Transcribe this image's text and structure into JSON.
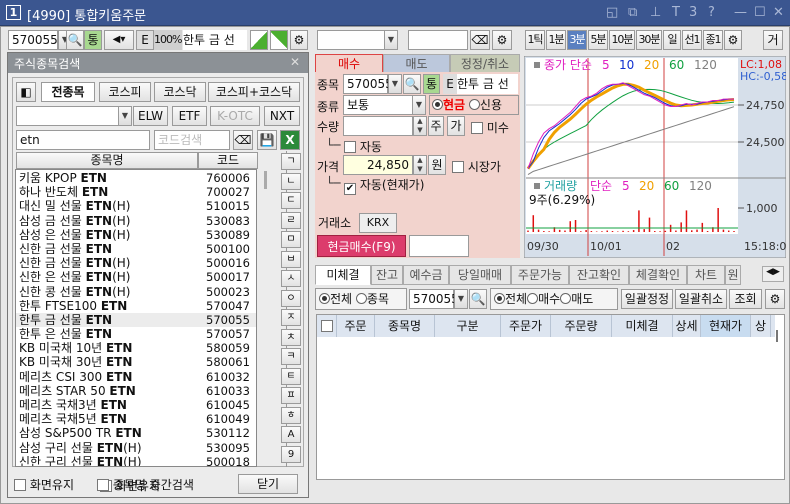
{
  "window": {
    "badge": "1",
    "title": "[4990] 통합키움주문",
    "icons": [
      "restore-layout-icon",
      "cascade-icon",
      "pin-icon",
      "font-icon",
      "three-icon",
      "help-icon",
      "minimize-icon",
      "maximize-icon",
      "close-icon"
    ],
    "icon_glyphs": [
      "◱",
      "⧉",
      "⊥",
      "T",
      "3",
      "?",
      "—",
      "☐",
      "✕"
    ]
  },
  "toolbar": {
    "code": "570055",
    "tong": "통",
    "e": "E",
    "ratio": "100%",
    "name": "한투 금 선"
  },
  "dialog": {
    "title": "주식종목검색",
    "close": "✕",
    "tabs": [
      "전종목",
      "코스피",
      "코스닥",
      "코스피+코스닥"
    ],
    "market_buttons": [
      "ELW",
      "ETF",
      "K-OTC",
      "NXT"
    ],
    "search_value": "etn",
    "code_placeholder": "코드검색",
    "col_name": "종목명",
    "col_code": "코드",
    "rows": [
      {
        "name": "키움 KPOP ",
        "bold": "ETN",
        "suffix": "",
        "code": "760006"
      },
      {
        "name": "하나 반도체 ",
        "bold": "ETN",
        "suffix": "",
        "code": "700027"
      },
      {
        "name": "대신 밀 선물 ",
        "bold": "ETN",
        "suffix": "(H)",
        "code": "510015"
      },
      {
        "name": "삼성 금 선물 ",
        "bold": "ETN",
        "suffix": "(H)",
        "code": "530083"
      },
      {
        "name": "삼성 은 선물 ",
        "bold": "ETN",
        "suffix": "(H)",
        "code": "530089"
      },
      {
        "name": "신한 금 선물 ",
        "bold": "ETN",
        "suffix": "",
        "code": "500100"
      },
      {
        "name": "신한 금 선물 ",
        "bold": "ETN",
        "suffix": "(H)",
        "code": "500016"
      },
      {
        "name": "신한 은 선물 ",
        "bold": "ETN",
        "suffix": "(H)",
        "code": "500017"
      },
      {
        "name": "신한 콩 선물 ",
        "bold": "ETN",
        "suffix": "(H)",
        "code": "500023"
      },
      {
        "name": "한투 FTSE100 ",
        "bold": "ETN",
        "suffix": "",
        "code": "570047"
      },
      {
        "name": "한투 금 선물 ",
        "bold": "ETN",
        "suffix": "",
        "code": "570055",
        "selected": true
      },
      {
        "name": "한투 은 선물 ",
        "bold": "ETN",
        "suffix": "",
        "code": "570057"
      },
      {
        "name": "KB 미국채 10년 ",
        "bold": "ETN",
        "suffix": "",
        "code": "580059"
      },
      {
        "name": "KB 미국채 30년 ",
        "bold": "ETN",
        "suffix": "",
        "code": "580061"
      },
      {
        "name": "메리츠 CSI 300 ",
        "bold": "ETN",
        "suffix": "",
        "code": "610032"
      },
      {
        "name": "메리츠 STAR 50 ",
        "bold": "ETN",
        "suffix": "",
        "code": "610033"
      },
      {
        "name": "메리츠 국채3년 ",
        "bold": "ETN",
        "suffix": "",
        "code": "610045"
      },
      {
        "name": "메리츠 국채5년 ",
        "bold": "ETN",
        "suffix": "",
        "code": "610049"
      },
      {
        "name": "삼성 S&P500 TR ",
        "bold": "ETN",
        "suffix": "",
        "code": "530112"
      },
      {
        "name": "삼성 구리 선물 ",
        "bold": "ETN",
        "suffix": "(H)",
        "code": "530095"
      },
      {
        "name": "신한 구리 선물 ",
        "bold": "ETN",
        "suffix": "(H)",
        "code": "500018"
      }
    ],
    "consonants": [
      "ㄱ",
      "ㄴ",
      "ㄷ",
      "ㄹ",
      "ㅁ",
      "ㅂ",
      "ㅅ",
      "ㅇ",
      "ㅈ",
      "ㅊ",
      "ㅋ",
      "ㅌ",
      "ㅍ",
      "ㅎ",
      "A",
      "9"
    ],
    "keep_screen": "화면유지",
    "middle_search": "종목명 중간검색",
    "close_button": "닫기"
  },
  "order": {
    "tabs": [
      "매수",
      "매도",
      "정정/취소"
    ],
    "stock_label": "종목",
    "code": "570055",
    "tong": "통",
    "e": "E",
    "name": "한투 금 선",
    "type_label": "종류",
    "type_value": "보통",
    "cash": "현금",
    "credit": "신용",
    "qty_label": "수량",
    "qty_value": "",
    "unit_share": "주",
    "unit_price": "가",
    "misu": "미수",
    "auto": "자동",
    "price_label": "가격",
    "price_value": "24,850",
    "won": "원",
    "market_price": "시장가",
    "auto_current": "자동(현재가)",
    "exchange_label": "거래소",
    "exchange": "KRX",
    "submit": "현금매수(F9)"
  },
  "chart": {
    "periods": [
      "1틱",
      "1분",
      "3분",
      "5분",
      "10분",
      "30분",
      "일",
      "선1",
      "종1"
    ],
    "active_period": "3분",
    "right_btn": "거",
    "price_legend": {
      "title": "종가 단순",
      "ma": [
        "5",
        "10",
        "20",
        "60",
        "120"
      ]
    },
    "lc": "LC:1,08",
    "hc": "HC:-0,58",
    "price_ticks": [
      "24,750",
      "24,500"
    ],
    "vol_legend": {
      "title": "거래량",
      "simple": "단순",
      "ma": [
        "5",
        "20",
        "60",
        "120"
      ]
    },
    "vol_info": "9주(6.29%)",
    "vol_tick": "1,000",
    "x_labels": [
      "09/30",
      "10/01",
      "02"
    ],
    "time": "15:18:0",
    "colors": {
      "ma5": "#e020c0",
      "ma10": "#1030d0",
      "ma20": "#f0a000",
      "ma60": "#10a040",
      "ma120": "#808080"
    },
    "price_series": [
      24320,
      24420,
      24500,
      24560,
      24590,
      24610,
      24640,
      24670,
      24700,
      24740,
      24780,
      24800,
      24810,
      24830,
      24860,
      24880,
      24890,
      24890,
      24900,
      24880,
      24860,
      24840,
      24820,
      24810,
      24790,
      24770,
      24750,
      24740,
      24740,
      24750,
      24760,
      24750,
      24760,
      24770,
      24770,
      24780,
      24780,
      24790,
      24790,
      24790
    ],
    "volume_series": [
      60,
      700,
      100,
      40,
      30,
      200,
      90,
      60,
      450,
      500,
      30,
      80,
      40,
      20,
      30,
      60,
      40,
      20,
      50,
      30,
      80,
      900,
      120,
      600,
      40,
      30,
      50,
      300,
      60,
      400,
      900,
      70,
      100,
      380,
      40,
      200,
      1000,
      100,
      60,
      40
    ]
  },
  "bottom": {
    "tabs": [
      "미체결",
      "잔고",
      "예수금",
      "당일매매",
      "주문가능",
      "잔고확인",
      "체결확인",
      "차트",
      "원"
    ],
    "filter_all": "전체",
    "filter_stock": "종목",
    "code": "570055",
    "side_all": "전체",
    "side_buy": "매수",
    "side_sell": "매도",
    "bulk_modify": "일괄정정",
    "bulk_cancel": "일괄취소",
    "query": "조회",
    "columns": [
      "주문",
      "종목명",
      "구분",
      "주문가",
      "주문량",
      "미체결",
      "상세",
      "현재가",
      "상"
    ]
  }
}
